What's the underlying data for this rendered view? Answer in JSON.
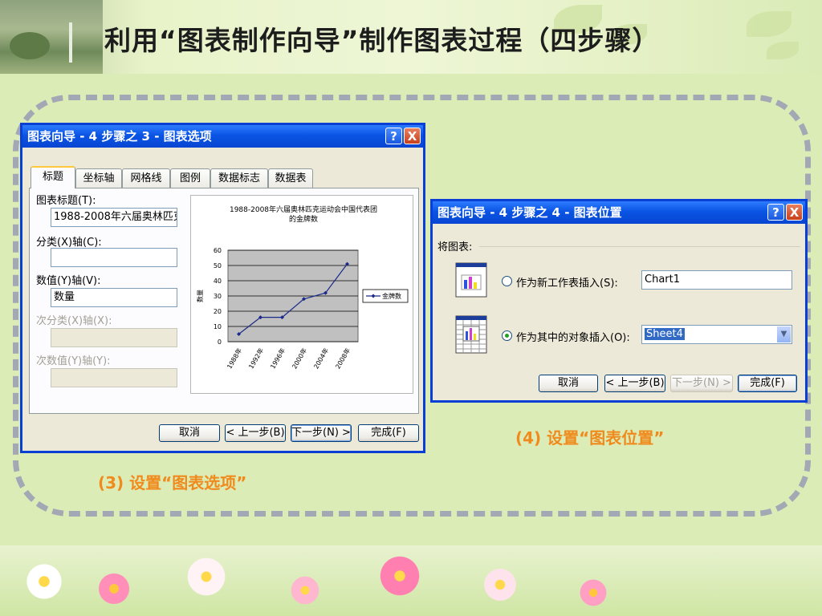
{
  "slide": {
    "title": "利用“图表制作向导”制作图表过程（四步骤）",
    "caption3": "(3) 设置“图表选项”",
    "caption4": "(4) 设置“图表位置”"
  },
  "dialog1": {
    "title": "图表向导 - 4 步骤之 3 - 图表选项",
    "help": "?",
    "close": "X",
    "tabs": [
      "标题",
      "坐标轴",
      "网格线",
      "图例",
      "数据标志",
      "数据表"
    ],
    "active_tab": 0,
    "fields": {
      "chart_title_label": "图表标题(T):",
      "chart_title_value": "1988-2008年六届奥林匹克运动会中国代表团的金牌数",
      "category_x_label": "分类(X)轴(C):",
      "category_x_value": "",
      "value_y_label": "数值(Y)轴(V):",
      "value_y_value": "数量",
      "secondary_x_label": "次分类(X)轴(X):",
      "secondary_y_label": "次数值(Y)轴(Y):"
    },
    "buttons": {
      "cancel": "取消",
      "back": "< 上一步(B)",
      "next": "下一步(N) >",
      "finish": "完成(F)"
    }
  },
  "dialog2": {
    "title": "图表向导 - 4 步骤之 4 - 图表位置",
    "help": "?",
    "close": "X",
    "group_label": "将图表:",
    "option_new_sheet": "作为新工作表插入(S):",
    "new_sheet_value": "Chart1",
    "option_object": "作为其中的对象插入(O):",
    "object_value": "Sheet4",
    "selected_option": "object",
    "buttons": {
      "cancel": "取消",
      "back": "< 上一步(B)",
      "next": "下一步(N) >",
      "finish": "完成(F)"
    }
  },
  "chart_data": {
    "type": "line",
    "title": "1988-2008年六届奥林匹克运动会中国代表团的金牌数",
    "categories": [
      "1988年",
      "1992年",
      "1996年",
      "2000年",
      "2004年",
      "2008年"
    ],
    "series": [
      {
        "name": "金牌数",
        "values": [
          5,
          16,
          16,
          28,
          32,
          51
        ]
      }
    ],
    "ylabel": "数量",
    "yticks": [
      "0",
      "10",
      "20",
      "30",
      "40",
      "50",
      "60"
    ],
    "ylim": [
      0,
      60
    ],
    "grid": true,
    "legend": "right",
    "colors": {
      "line": "#1a2a8a",
      "plot_bg": "#c0c0c0"
    }
  },
  "colors": {
    "titlebar": "#0a54e4",
    "dialog_bg": "#ece9d8",
    "caption": "#f08a1c"
  }
}
